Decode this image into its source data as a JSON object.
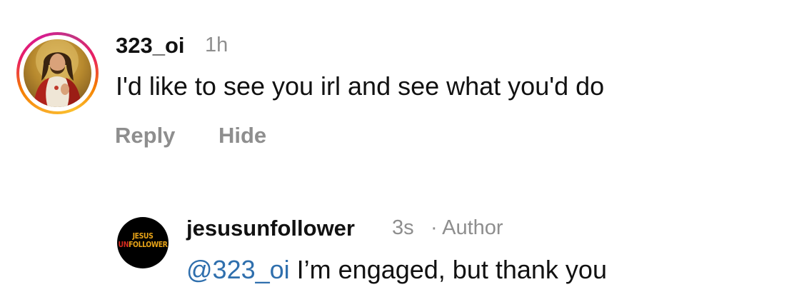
{
  "colors": {
    "text": "#111111",
    "muted": "#8e8e8e",
    "mention": "#2f6fad",
    "story_ring_start": "#f9a825",
    "story_ring_end": "#c13584",
    "logo_gold": "#e8a317",
    "logo_red": "#d12a1f"
  },
  "comments": [
    {
      "avatar_icon": "jesus-portrait-avatar",
      "has_story_ring": true,
      "username": "323_oi",
      "time": "1h",
      "text": "I'd like to see you irl and see what you'd do",
      "actions": {
        "reply": "Reply",
        "hide": "Hide"
      }
    },
    {
      "avatar_icon": "jesus-unfollower-logo-avatar",
      "avatar_logo_line1": "JESUS",
      "avatar_logo_line2_prefix": "UN",
      "avatar_logo_line2_rest": "FOLLOWER",
      "username": "jesusunfollower",
      "time": "3s",
      "separator": "·",
      "badge": "Author",
      "mention": "@323_oi",
      "text": " I’m engaged, but thank you"
    }
  ]
}
